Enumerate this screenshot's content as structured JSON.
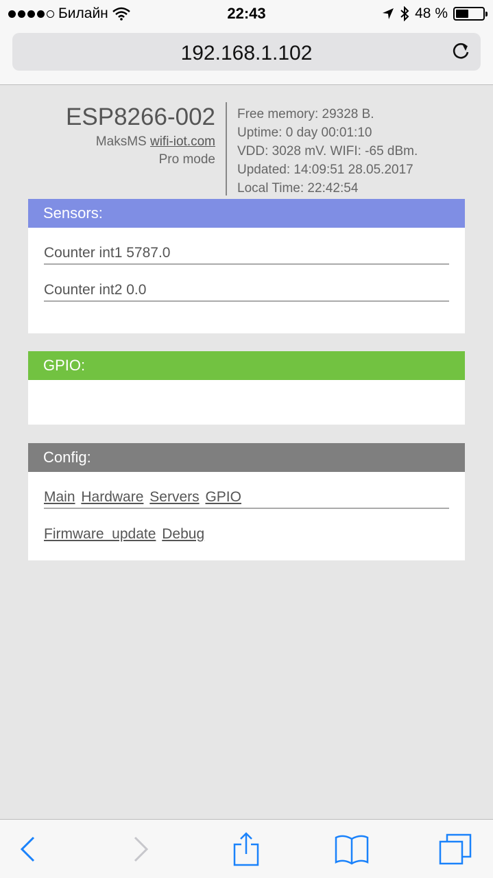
{
  "status_bar": {
    "carrier": "Билайн",
    "time": "22:43",
    "battery_percent": "48 %",
    "battery_level": 0.48
  },
  "browser": {
    "url": "192.168.1.102"
  },
  "header": {
    "device_name": "ESP8266-002",
    "author": "MaksMS",
    "site_link": "wifi-iot.com",
    "mode": "Pro mode",
    "info": {
      "free_memory": "Free memory: 29328 B.",
      "uptime": "Uptime: 0 day 00:01:10",
      "vdd_wifi": "VDD: 3028 mV. WIFI: -65 dBm.",
      "updated": "Updated: 14:09:51 28.05.2017",
      "local_time": "Local Time: 22:42:54"
    }
  },
  "sensors": {
    "title": "Sensors:",
    "color": "#7f8ee4",
    "rows": [
      "Counter int1 5787.0",
      "Counter int2 0.0"
    ]
  },
  "gpio": {
    "title": "GPIO:",
    "color": "#72c241"
  },
  "config": {
    "title": "Config:",
    "color": "#7f7f7f",
    "links": {
      "main": "Main",
      "hardware": "Hardware",
      "servers": "Servers",
      "gpio": "GPIO",
      "firmware_update": "Firmware_update",
      "debug": "Debug"
    }
  },
  "toolbar": {
    "accent": "#1a82fb",
    "icons": [
      "back-icon",
      "forward-icon",
      "share-icon",
      "bookmarks-icon",
      "tabs-icon"
    ]
  }
}
